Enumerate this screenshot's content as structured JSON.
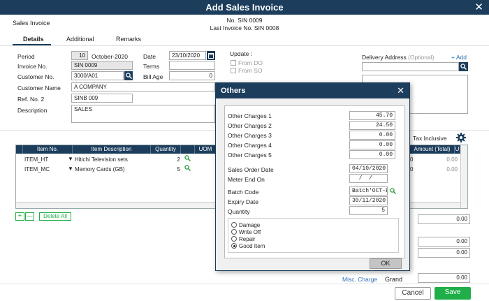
{
  "window": {
    "title": "Add Sales Invoice",
    "close_glyph": "✕"
  },
  "header": {
    "doc_type": "Sales Invoice",
    "doc_no": "No. SIN 0009",
    "last_invoice": "Last Invoice No. SIN 0008"
  },
  "tabs": [
    {
      "label": "Details",
      "active": true
    },
    {
      "label": "Additional",
      "active": false
    },
    {
      "label": "Remarks",
      "active": false
    }
  ],
  "form": {
    "period_label": "Period",
    "period_value": "10",
    "period_text": "October-2020",
    "date_label": "Date",
    "date_value": "23/10/2020",
    "invoice_label": "Invoice No.",
    "invoice_value": "SIN 0009",
    "terms_label": "Terms",
    "terms_value": "",
    "customer_no_label": "Customer No.",
    "customer_no_value": "3000/A01",
    "bill_age_label": "Bill Age",
    "bill_age_value": "0",
    "customer_name_label": "Customer Name",
    "customer_name_value": "A COMPANY",
    "ref_label": "Ref. No. 2",
    "ref_value": "SINB 009",
    "desc_label": "Description",
    "desc_value": "SALES",
    "update_label": "Update :",
    "from_do": "From DO",
    "from_so": "From SO",
    "delivery_label": "Delivery Address",
    "delivery_optional": "(Optional)",
    "add_link": "+ Add"
  },
  "grid": {
    "tax_inclusive": "Tax Inclusive",
    "columns": [
      "Item No.",
      "Item Description",
      "Quantity",
      "UOM",
      "Amount (Total)",
      "U"
    ],
    "rows": [
      {
        "item_no": "ITEM_HT",
        "desc": "Hitichi Television sets",
        "qty": "2",
        "amount": "0.00"
      },
      {
        "item_no": "ITEM_MC",
        "desc": "Memory Cards (GB)",
        "qty": "5",
        "amount": "0.00"
      }
    ],
    "partial_amounts": [
      "0",
      "0"
    ],
    "add_glyph": "+",
    "remove_glyph": "—",
    "delete_all": "Delete All"
  },
  "totals": {
    "values": [
      "0.00",
      "0.00",
      "0.00",
      "0.00"
    ],
    "misc_charge": "Misc. Charge",
    "grand_label": "Grand"
  },
  "footer": {
    "cancel": "Cancel",
    "save": "Save"
  },
  "dialog": {
    "title": "Others",
    "close_glyph": "✕",
    "charges": [
      {
        "label": "Other Charges 1",
        "value": "45.70"
      },
      {
        "label": "Other Charges 2",
        "value": "24.50"
      },
      {
        "label": "Other Charges 3",
        "value": "0.00"
      },
      {
        "label": "Other Charges 4",
        "value": "0.00"
      },
      {
        "label": "Other Charges 5",
        "value": "0.00"
      }
    ],
    "so_date_label": "Sales Order Date",
    "so_date_value": "04/10/2020",
    "meter_label": "Meter End On",
    "meter_value": "  /  /",
    "batch_label": "Batch Code",
    "batch_value": "Batch'OCT-B",
    "expiry_label": "Expiry Date",
    "expiry_value": "30/11/2020",
    "qty_label": "Quantity",
    "qty_value": "5",
    "options": [
      {
        "label": "Damage",
        "selected": false
      },
      {
        "label": "Write Off",
        "selected": false
      },
      {
        "label": "Repair",
        "selected": false
      },
      {
        "label": "Good Item",
        "selected": true
      }
    ],
    "ok": "OK"
  },
  "colors": {
    "navy": "#1c3d5c",
    "green": "#1fae48",
    "link": "#2a6fb5"
  }
}
